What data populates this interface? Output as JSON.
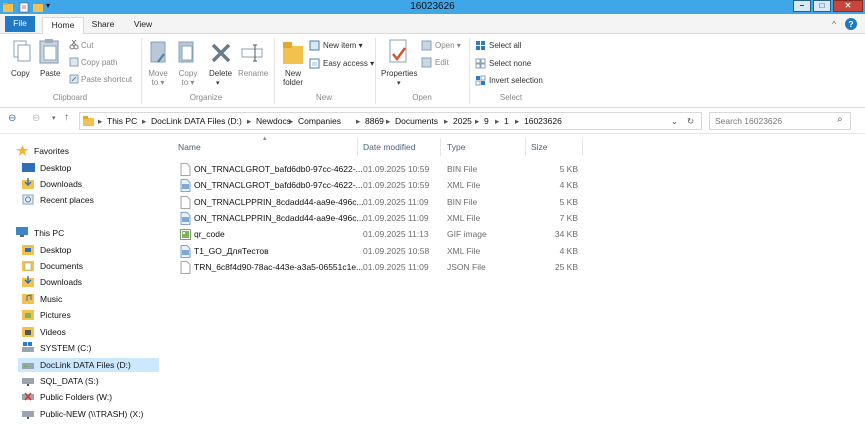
{
  "window": {
    "title": "16023626",
    "min": "–",
    "max": "□",
    "close": "✕"
  },
  "tabs": {
    "file": "File",
    "home": "Home",
    "share": "Share",
    "view": "View",
    "help": "?",
    "collapse": "^"
  },
  "ribbon": {
    "clipboard": {
      "copy": "Copy",
      "paste": "Paste",
      "cut": "Cut",
      "copy_path": "Copy path",
      "paste_shortcut": "Paste shortcut",
      "group": "Clipboard"
    },
    "organize": {
      "move_to": "Move to ▾",
      "copy_to": "Copy to ▾",
      "delete": "Delete",
      "rename": "Rename",
      "group": "Organize"
    },
    "new": {
      "new_item": "New item ▾",
      "easy_access": "Easy access ▾",
      "new_folder": "New folder",
      "group": "New"
    },
    "open": {
      "open": "Open ▾",
      "edit": "Edit",
      "properties": "Properties",
      "group": "Open"
    },
    "select": {
      "select_all": "Select all",
      "select_none": "Select none",
      "invert": "Invert selection",
      "group": "Select"
    }
  },
  "address": {
    "crumbs": [
      "This PC",
      "DocLink DATA Files (D:)",
      "Newdocs",
      "Companies",
      "8869",
      "Documents",
      "2025",
      "9",
      "1",
      "16023626"
    ],
    "search_placeholder": "Search 16023626"
  },
  "nav": {
    "favorites": "Favorites",
    "desktop": "Desktop",
    "downloads": "Downloads",
    "recent": "Recent places",
    "this_pc": "This PC",
    "pc_desktop": "Desktop",
    "documents": "Documents",
    "pc_downloads": "Downloads",
    "music": "Music",
    "pictures": "Pictures",
    "videos": "Videos",
    "system": "SYSTEM (C:)",
    "doclink": "DocLink DATA Files (D:)",
    "sql": "SQL_DATA (S:)",
    "public": "Public Folders (W:)",
    "public_new": "Public-NEW (\\\\TRASH) (X:)"
  },
  "columns": {
    "name": "Name",
    "date": "Date modified",
    "type": "Type",
    "size": "Size"
  },
  "files": [
    {
      "name": "ON_TRNACLGROT_bafd6db0-97cc-4622-...",
      "date": "01.09.2025 10:59",
      "type": "BIN File",
      "size": "5 KB",
      "icon": "blank-file-icon"
    },
    {
      "name": "ON_TRNACLGROT_bafd6db0-97cc-4622-...",
      "date": "01.09.2025 10:59",
      "type": "XML File",
      "size": "4 KB",
      "icon": "xml-file-icon"
    },
    {
      "name": "ON_TRNACLPPRIN_8cdadd44-aa9e-496c...",
      "date": "01.09.2025 11:09",
      "type": "BIN File",
      "size": "5 KB",
      "icon": "blank-file-icon"
    },
    {
      "name": "ON_TRNACLPPRIN_8cdadd44-aa9e-496c...",
      "date": "01.09.2025 11:09",
      "type": "XML File",
      "size": "7 KB",
      "icon": "xml-file-icon"
    },
    {
      "name": "qr_code",
      "date": "01.09.2025 11:13",
      "type": "GIF image",
      "size": "34 KB",
      "icon": "gif-image-icon"
    },
    {
      "name": "T1_GO_ДляТестов",
      "date": "01.09.2025 10:58",
      "type": "XML File",
      "size": "4 KB",
      "icon": "xml-file-icon"
    },
    {
      "name": "TRN_6c8f4d90-78ac-443e-a3a5-06551c1e...",
      "date": "01.09.2025 11:09",
      "type": "JSON File",
      "size": "25 KB",
      "icon": "blank-file-icon"
    }
  ],
  "colors": {
    "titlebar": "#3fa6e8",
    "file_tab": "#1f79c4",
    "selection": "#cce8ff",
    "header_text": "#4c607a"
  }
}
